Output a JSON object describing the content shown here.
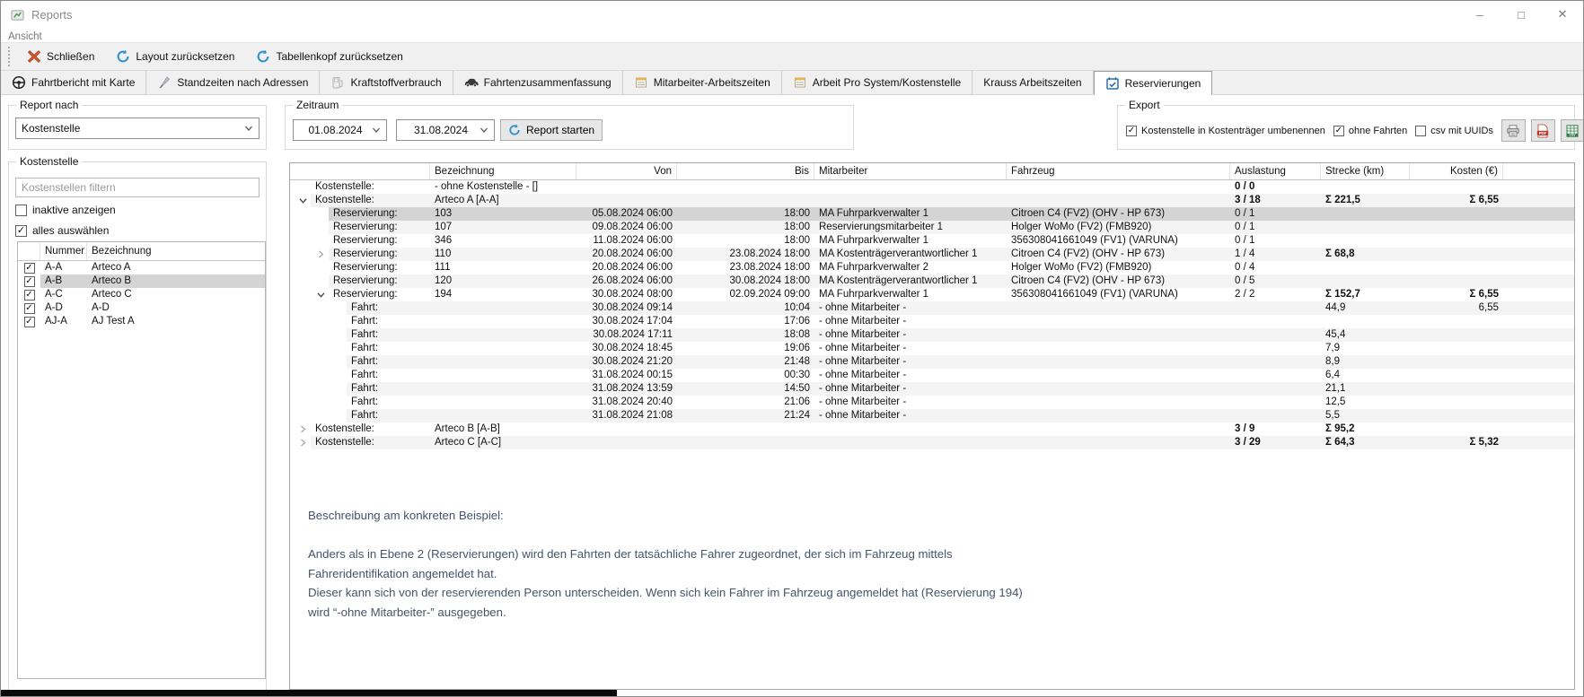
{
  "window": {
    "title": "Reports",
    "menu_item": "Ansicht",
    "controls": {
      "minimize": "–",
      "maximize": "□",
      "close": "✕"
    }
  },
  "toolbar": {
    "close_label": "Schließen",
    "reset_layout_label": "Layout zurücksetzen",
    "reset_tablehead_label": "Tabellenkopf zurücksetzen"
  },
  "tabs": [
    {
      "label": "Fahrtbericht mit Karte",
      "icon": "steering-wheel-icon",
      "active": false
    },
    {
      "label": "Standzeiten nach Adressen",
      "icon": "flag-icon",
      "active": false
    },
    {
      "label": "Kraftstoffverbrauch",
      "icon": "fuel-pump-icon",
      "active": false
    },
    {
      "label": "Fahrtenzusammenfassung",
      "icon": "car-icon",
      "active": false
    },
    {
      "label": "Mitarbeiter-Arbeitszeiten",
      "icon": "sheet-icon",
      "active": false
    },
    {
      "label": "Arbeit Pro System/Kostenstelle",
      "icon": "sheet-icon",
      "active": false
    },
    {
      "label": "Krauss Arbeitszeiten",
      "icon": null,
      "active": false
    },
    {
      "label": "Reservierungen",
      "icon": "calendar-check-icon",
      "active": true
    }
  ],
  "sidebar": {
    "report_nach_label": "Report nach",
    "report_nach_value": "Kostenstelle",
    "kostenstelle_label": "Kostenstelle",
    "filter_placeholder": "Kostenstellen filtern",
    "inactive_checkbox": {
      "label": "inaktive anzeigen",
      "checked": false
    },
    "select_all_checkbox": {
      "label": "alles auswählen",
      "checked": true
    },
    "list": {
      "columns": [
        "Nummer",
        "Bezeichnung"
      ],
      "rows": [
        {
          "checked": true,
          "nummer": "A-A",
          "bezeichnung": "Arteco A",
          "selected": false
        },
        {
          "checked": true,
          "nummer": "A-B",
          "bezeichnung": "Arteco B",
          "selected": true
        },
        {
          "checked": true,
          "nummer": "A-C",
          "bezeichnung": "Arteco C",
          "selected": false
        },
        {
          "checked": true,
          "nummer": "A-D",
          "bezeichnung": "A-D",
          "selected": false
        },
        {
          "checked": true,
          "nummer": "AJ-A",
          "bezeichnung": "AJ Test A",
          "selected": false
        }
      ]
    }
  },
  "zeitraum": {
    "label": "Zeitraum",
    "date_from": "01.08.2024",
    "date_to": "31.08.2024",
    "start_button_label": "Report starten"
  },
  "export": {
    "label": "Export",
    "checkboxes": [
      {
        "label": "Kostenstelle in Kostenträger umbenennen",
        "checked": true
      },
      {
        "label": "ohne Fahrten",
        "checked": true
      },
      {
        "label": "csv mit UUIDs",
        "checked": false
      }
    ],
    "buttons": [
      {
        "icon": "printer-icon"
      },
      {
        "icon": "pdf-icon"
      },
      {
        "icon": "csv-icon"
      }
    ]
  },
  "report_table": {
    "columns": [
      "",
      "Bezeichnung",
      "Von",
      "Bis",
      "Mitarbeiter",
      "Fahrzeug",
      "Auslastung",
      "Strecke (km)",
      "Kosten (€)"
    ],
    "rows": [
      {
        "type": "Kostenstelle:",
        "level": 0,
        "expander": null,
        "bezeichnung": "- ohne Kostenstelle - []",
        "von": "",
        "bis": "",
        "mitarbeiter": "",
        "fahrzeug": "",
        "auslastung": "0 / 0",
        "strecke": "",
        "kosten": "",
        "selected": false
      },
      {
        "type": "Kostenstelle:",
        "level": 0,
        "expander": "open",
        "bezeichnung": "Arteco A [A-A]",
        "von": "",
        "bis": "",
        "mitarbeiter": "",
        "fahrzeug": "",
        "auslastung": "3 / 18",
        "strecke": "Σ 221,5",
        "kosten": "Σ 6,55",
        "selected": false
      },
      {
        "type": "Reservierung:",
        "level": 1,
        "expander": null,
        "bezeichnung": "103",
        "von": "05.08.2024 06:00",
        "bis": "18:00",
        "mitarbeiter": "MA Fuhrparkverwalter 1",
        "fahrzeug": "Citroen C4 (FV2) (OHV - HP 673)",
        "auslastung": "0 / 1",
        "strecke": "",
        "kosten": "",
        "selected": true
      },
      {
        "type": "Reservierung:",
        "level": 1,
        "expander": null,
        "bezeichnung": "107",
        "von": "09.08.2024 06:00",
        "bis": "18:00",
        "mitarbeiter": "Reservierungsmitarbeiter 1",
        "fahrzeug": "Holger WoMo (FV2) (FMB920)",
        "auslastung": "0 / 1",
        "strecke": "",
        "kosten": "",
        "selected": false
      },
      {
        "type": "Reservierung:",
        "level": 1,
        "expander": null,
        "bezeichnung": "346",
        "von": "11.08.2024 06:00",
        "bis": "18:00",
        "mitarbeiter": "MA Fuhrparkverwalter 1",
        "fahrzeug": "356308041661049 (FV1) (VARUNA)",
        "auslastung": "0 / 1",
        "strecke": "",
        "kosten": "",
        "selected": false
      },
      {
        "type": "Reservierung:",
        "level": 1,
        "expander": "closed",
        "bezeichnung": "110",
        "von": "20.08.2024 06:00",
        "bis": "23.08.2024 18:00",
        "mitarbeiter": "MA Kostenträgerverantwortlicher 1",
        "fahrzeug": "Citroen C4 (FV2) (OHV - HP 673)",
        "auslastung": "1 / 4",
        "strecke": "Σ 68,8",
        "kosten": "",
        "selected": false
      },
      {
        "type": "Reservierung:",
        "level": 1,
        "expander": null,
        "bezeichnung": "111",
        "von": "20.08.2024 06:00",
        "bis": "23.08.2024 18:00",
        "mitarbeiter": "MA Fuhrparkverwalter 2",
        "fahrzeug": "Holger WoMo (FV2) (FMB920)",
        "auslastung": "0 / 4",
        "strecke": "",
        "kosten": "",
        "selected": false
      },
      {
        "type": "Reservierung:",
        "level": 1,
        "expander": null,
        "bezeichnung": "120",
        "von": "26.08.2024 06:00",
        "bis": "30.08.2024 18:00",
        "mitarbeiter": "MA Kostenträgerverantwortlicher 1",
        "fahrzeug": "Citroen C4 (FV2) (OHV - HP 673)",
        "auslastung": "0 / 5",
        "strecke": "",
        "kosten": "",
        "selected": false
      },
      {
        "type": "Reservierung:",
        "level": 1,
        "expander": "open",
        "bezeichnung": "194",
        "von": "30.08.2024 08:00",
        "bis": "02.09.2024 09:00",
        "mitarbeiter": "MA Fuhrparkverwalter 1",
        "fahrzeug": "356308041661049 (FV1) (VARUNA)",
        "auslastung": "2 / 2",
        "strecke": "Σ 152,7",
        "kosten": "Σ 6,55",
        "selected": false
      },
      {
        "type": "Fahrt:",
        "level": 2,
        "expander": null,
        "bezeichnung": "",
        "von": "30.08.2024 09:14",
        "bis": "10:04",
        "mitarbeiter": "- ohne Mitarbeiter -",
        "fahrzeug": "",
        "auslastung": "",
        "strecke": "44,9",
        "kosten": "6,55",
        "selected": false
      },
      {
        "type": "Fahrt:",
        "level": 2,
        "expander": null,
        "bezeichnung": "",
        "von": "30.08.2024 17:04",
        "bis": "17:06",
        "mitarbeiter": "- ohne Mitarbeiter -",
        "fahrzeug": "",
        "auslastung": "",
        "strecke": "",
        "kosten": "",
        "selected": false
      },
      {
        "type": "Fahrt:",
        "level": 2,
        "expander": null,
        "bezeichnung": "",
        "von": "30.08.2024 17:11",
        "bis": "18:08",
        "mitarbeiter": "- ohne Mitarbeiter -",
        "fahrzeug": "",
        "auslastung": "",
        "strecke": "45,4",
        "kosten": "",
        "selected": false
      },
      {
        "type": "Fahrt:",
        "level": 2,
        "expander": null,
        "bezeichnung": "",
        "von": "30.08.2024 18:45",
        "bis": "19:06",
        "mitarbeiter": "- ohne Mitarbeiter -",
        "fahrzeug": "",
        "auslastung": "",
        "strecke": "7,9",
        "kosten": "",
        "selected": false
      },
      {
        "type": "Fahrt:",
        "level": 2,
        "expander": null,
        "bezeichnung": "",
        "von": "30.08.2024 21:20",
        "bis": "21:48",
        "mitarbeiter": "- ohne Mitarbeiter -",
        "fahrzeug": "",
        "auslastung": "",
        "strecke": "8,9",
        "kosten": "",
        "selected": false
      },
      {
        "type": "Fahrt:",
        "level": 2,
        "expander": null,
        "bezeichnung": "",
        "von": "31.08.2024 00:15",
        "bis": "00:30",
        "mitarbeiter": "- ohne Mitarbeiter -",
        "fahrzeug": "",
        "auslastung": "",
        "strecke": "6,4",
        "kosten": "",
        "selected": false
      },
      {
        "type": "Fahrt:",
        "level": 2,
        "expander": null,
        "bezeichnung": "",
        "von": "31.08.2024 13:59",
        "bis": "14:50",
        "mitarbeiter": "- ohne Mitarbeiter -",
        "fahrzeug": "",
        "auslastung": "",
        "strecke": "21,1",
        "kosten": "",
        "selected": false
      },
      {
        "type": "Fahrt:",
        "level": 2,
        "expander": null,
        "bezeichnung": "",
        "von": "31.08.2024 20:40",
        "bis": "21:06",
        "mitarbeiter": "- ohne Mitarbeiter -",
        "fahrzeug": "",
        "auslastung": "",
        "strecke": "12,5",
        "kosten": "",
        "selected": false
      },
      {
        "type": "Fahrt:",
        "level": 2,
        "expander": null,
        "bezeichnung": "",
        "von": "31.08.2024 21:08",
        "bis": "21:24",
        "mitarbeiter": "- ohne Mitarbeiter -",
        "fahrzeug": "",
        "auslastung": "",
        "strecke": "5,5",
        "kosten": "",
        "selected": false
      },
      {
        "type": "Kostenstelle:",
        "level": 0,
        "expander": "closed",
        "bezeichnung": "Arteco B [A-B]",
        "von": "",
        "bis": "",
        "mitarbeiter": "",
        "fahrzeug": "",
        "auslastung": "3 / 9",
        "strecke": "Σ 95,2",
        "kosten": "",
        "selected": false
      },
      {
        "type": "Kostenstelle:",
        "level": 0,
        "expander": "closed",
        "bezeichnung": "Arteco C [A-C]",
        "von": "",
        "bis": "",
        "mitarbeiter": "",
        "fahrzeug": "",
        "auslastung": "3 / 29",
        "strecke": "Σ 64,3",
        "kosten": "Σ 5,32",
        "selected": false
      }
    ]
  },
  "description": {
    "lines": [
      "Beschreibung am konkreten Beispiel:",
      "",
      "Anders als in Ebene 2 (Reservierungen) wird den Fahrten der tatsächliche Fahrer zugeordnet, der sich im Fahrzeug mittels",
      "Fahreridentifikation angemeldet hat.",
      "Dieser kann sich von der reservierenden Person unterscheiden. Wenn sich kein Fahrer im Fahrzeug angemeldet hat (Reservierung 194)",
      "wird “-ohne Mitarbeiter-” ausgegeben."
    ]
  },
  "colors": {
    "description_text": "#44546A",
    "selection": "#d4d4d4",
    "stripe": "#f4f4f4",
    "calendar_blue": "#2f6fa8",
    "close_x_orange": "#d35427",
    "refresh_blue": "#2e93cf"
  }
}
